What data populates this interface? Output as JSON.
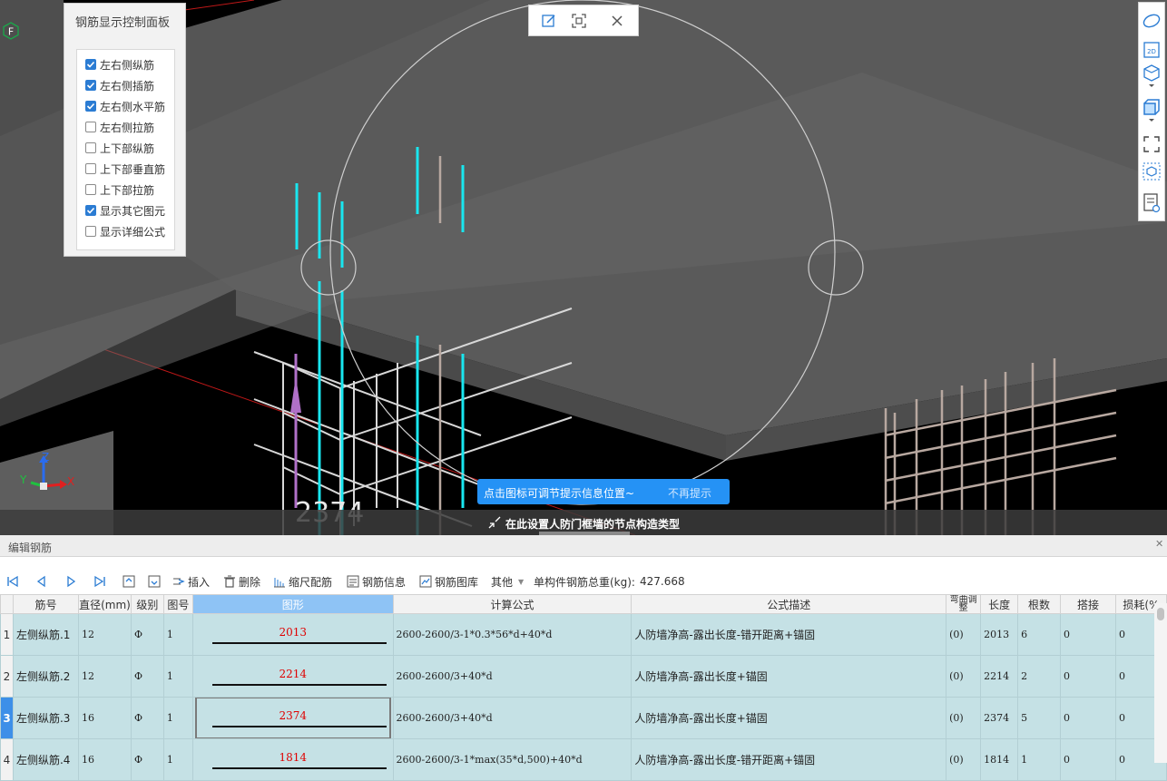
{
  "viewport": {
    "control_panel": {
      "title": "钢筋显示控制面板",
      "options": [
        {
          "label": "左右侧纵筋",
          "checked": true
        },
        {
          "label": "左右侧插筋",
          "checked": true
        },
        {
          "label": "左右侧水平筋",
          "checked": true
        },
        {
          "label": "左右侧拉筋",
          "checked": false
        },
        {
          "label": "上下部纵筋",
          "checked": false
        },
        {
          "label": "上下部垂直筋",
          "checked": false
        },
        {
          "label": "上下部拉筋",
          "checked": false
        },
        {
          "label": "显示其它图元",
          "checked": true
        },
        {
          "label": "显示详细公式",
          "checked": false
        }
      ]
    },
    "top_toolbar": {
      "icons": [
        "edit-icon",
        "scan-icon",
        "close-icon"
      ]
    },
    "right_toolbar": {
      "icons": [
        "orbit-icon",
        "2d-view-icon",
        "3d-view-icon",
        "box-icon",
        "fullscreen-icon",
        "component-icon",
        "report-icon"
      ],
      "label_2d": "2D"
    },
    "compass_label": "F",
    "axis_labels": {
      "x": "X",
      "y": "Y",
      "z": "Z"
    },
    "dimension_text": "2374",
    "tooltip": {
      "text": "点击图标可调节提示信息位置~",
      "link": "不再提示"
    },
    "status_hint": "在此设置人防门框墙的节点构造类型"
  },
  "editor": {
    "title": "编辑钢筋",
    "toolbar": {
      "insert": "插入",
      "delete": "删除",
      "scale_rebar": "缩尺配筋",
      "rebar_info": "钢筋信息",
      "rebar_library": "钢筋图库",
      "other": "其他",
      "total_weight_label": "单构件钢筋总重(kg):",
      "total_weight_value": "427.668"
    },
    "columns": [
      "筋号",
      "直径(mm)",
      "级别",
      "图号",
      "图形",
      "计算公式",
      "公式描述",
      "弯曲调整",
      "长度",
      "根数",
      "搭接",
      "损耗(%"
    ],
    "rows": [
      {
        "no": "1",
        "name": "左侧纵筋.1",
        "dia": "12",
        "grade": "Φ",
        "fig": "1",
        "shape_value": "2013",
        "formula": "2600-2600/3-1*0.3*56*d+40*d",
        "desc": "人防墙净高-露出长度-错开距离+锚固",
        "bend": "(0)",
        "length": "2013",
        "count": "6",
        "lap": "0",
        "loss": "0"
      },
      {
        "no": "2",
        "name": "左侧纵筋.2",
        "dia": "12",
        "grade": "Φ",
        "fig": "1",
        "shape_value": "2214",
        "formula": "2600-2600/3+40*d",
        "desc": "人防墙净高-露出长度+锚固",
        "bend": "(0)",
        "length": "2214",
        "count": "2",
        "lap": "0",
        "loss": "0"
      },
      {
        "no": "3",
        "name": "左侧纵筋.3",
        "dia": "16",
        "grade": "Φ",
        "fig": "1",
        "shape_value": "2374",
        "formula": "2600-2600/3+40*d",
        "desc": "人防墙净高-露出长度+锚固",
        "bend": "(0)",
        "length": "2374",
        "count": "5",
        "lap": "0",
        "loss": "0"
      },
      {
        "no": "4",
        "name": "左侧纵筋.4",
        "dia": "16",
        "grade": "Φ",
        "fig": "1",
        "shape_value": "1814",
        "formula": "2600-2600/3-1*max(35*d,500)+40*d",
        "desc": "人防墙净高-露出长度-错开距离+锚固",
        "bend": "(0)",
        "length": "1814",
        "count": "1",
        "lap": "0",
        "loss": "0"
      }
    ]
  }
}
